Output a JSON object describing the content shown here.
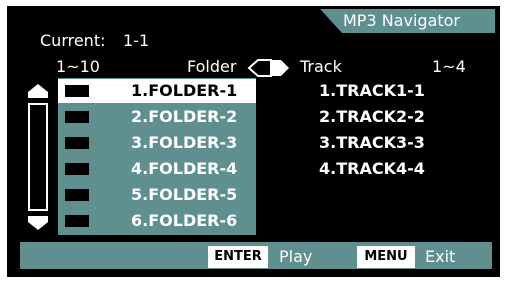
{
  "header": {
    "current_label": "Current:",
    "current_value": "1-1",
    "app_title": "MP3 Navigator"
  },
  "columns": {
    "folder_range": "1~10",
    "folder_label": "Folder",
    "track_label": "Track",
    "track_range": "1~4"
  },
  "folders": [
    {
      "label": "1.FOLDER-1",
      "selected": true
    },
    {
      "label": "2.FOLDER-2",
      "selected": false
    },
    {
      "label": "3.FOLDER-3",
      "selected": false
    },
    {
      "label": "4.FOLDER-4",
      "selected": false
    },
    {
      "label": "5.FOLDER-5",
      "selected": false
    },
    {
      "label": "6.FOLDER-6",
      "selected": false
    }
  ],
  "tracks": [
    {
      "label": "1.TRACK1-1"
    },
    {
      "label": "2.TRACK2-2"
    },
    {
      "label": "3.TRACK3-3"
    },
    {
      "label": "4.TRACK4-4"
    }
  ],
  "footer": {
    "enter_key": "ENTER",
    "enter_action": "Play",
    "menu_key": "MENU",
    "menu_action": "Exit"
  },
  "colors": {
    "screen": "#000000",
    "panel": "#5f8f8f",
    "highlight": "#ffffff"
  }
}
